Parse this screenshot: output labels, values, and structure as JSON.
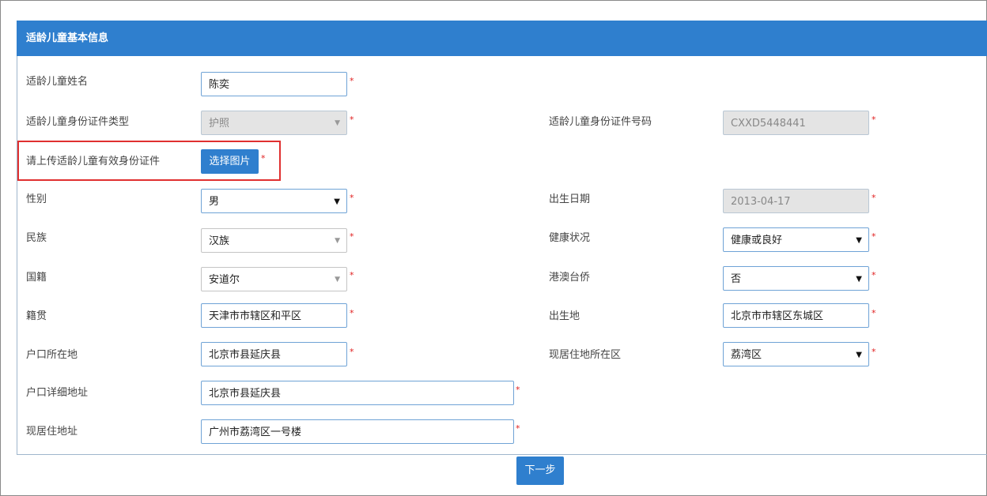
{
  "panel": {
    "title": "适龄儿童基本信息"
  },
  "required_mark": "*",
  "fields": {
    "name": {
      "label": "适龄儿童姓名",
      "value": "陈奕"
    },
    "id_type": {
      "label": "适龄儿童身份证件类型",
      "value": "护照"
    },
    "id_number": {
      "label": "适龄儿童身份证件号码",
      "value": "CXXD5448441"
    },
    "upload": {
      "label": "请上传适龄儿童有效身份证件",
      "button": "选择图片"
    },
    "gender": {
      "label": "性别",
      "value": "男"
    },
    "birth_date": {
      "label": "出生日期",
      "value": "2013-04-17"
    },
    "ethnicity": {
      "label": "民族",
      "value": "汉族"
    },
    "health": {
      "label": "健康状况",
      "value": "健康或良好"
    },
    "nationality": {
      "label": "国籍",
      "value": "安道尔"
    },
    "hk_macau_tw": {
      "label": "港澳台侨",
      "value": "否"
    },
    "native_place": {
      "label": "籍贯",
      "value": "天津市市辖区和平区"
    },
    "birthplace": {
      "label": "出生地",
      "value": "北京市市辖区东城区"
    },
    "hukou_location": {
      "label": "户口所在地",
      "value": "北京市县延庆县"
    },
    "residence_district": {
      "label": "现居住地所在区",
      "value": "荔湾区"
    },
    "hukou_address": {
      "label": "户口详细地址",
      "value": "北京市县延庆县"
    },
    "current_address": {
      "label": "现居住地址",
      "value": "广州市荔湾区一号楼"
    }
  },
  "next_button": "下一步",
  "colors": {
    "header": "#2f7fce",
    "required": "#e02020",
    "highlight": "#e03030"
  }
}
